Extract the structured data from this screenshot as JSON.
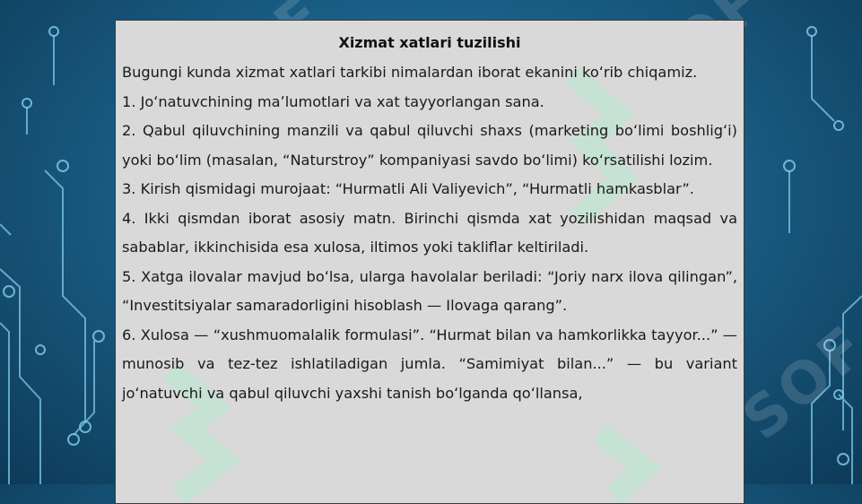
{
  "document": {
    "title": "Xizmat xatlari tuzilishi",
    "paragraphs": [
      "Bugungi kunda xizmat xatlari tarkibi nimalardan iborat ekanini koʻrib chiqamiz.",
      "1.  Joʻnatuvchining maʼlumotlari va xat tayyorlangan sana.",
      "2.  Qabul qiluvchining manzili va qabul qiluvchi shaxs (marketing boʻlimi boshligʻi) yoki boʻlim (masalan, “Naturstroy” kompaniyasi savdo boʻlimi) koʻrsatilishi lozim.",
      "3.  Kirish qismidagi murojaat: “Hurmatli Ali Valiyevich”, “Hurmatli hamkasblar”.",
      "4.  Ikki qismdan iborat asosiy matn. Birinchi qismda xat yozilishidan maqsad va sabablar, ikkinchisida esa xulosa, iltimos yoki takliflar keltiriladi.",
      "5.  Xatga ilovalar mavjud boʻlsa, ularga havolalar beriladi: “Joriy narx ilova qilingan”, “Investitsiyalar samaradorligini hisoblash — Ilovaga qarang”.",
      "6.  Xulosa — “xushmuomalalik formulasi”. “Hurmat bilan va hamkorlikka tayyor...” — munosib va tez-tez ishlatiladigan jumla. “Samimiyat bilan...” — bu variant joʻnatuvchi va qabul qiluvchi yaxshi tanish boʻlganda qoʻllansa,"
    ]
  },
  "watermark": {
    "text": "SOF",
    "color": "#ffffff",
    "accent": "#7fe3b0"
  },
  "colors": {
    "panel": "#d9d9d9",
    "background": "#1a5f86",
    "circuit": "#7ec8e8"
  }
}
